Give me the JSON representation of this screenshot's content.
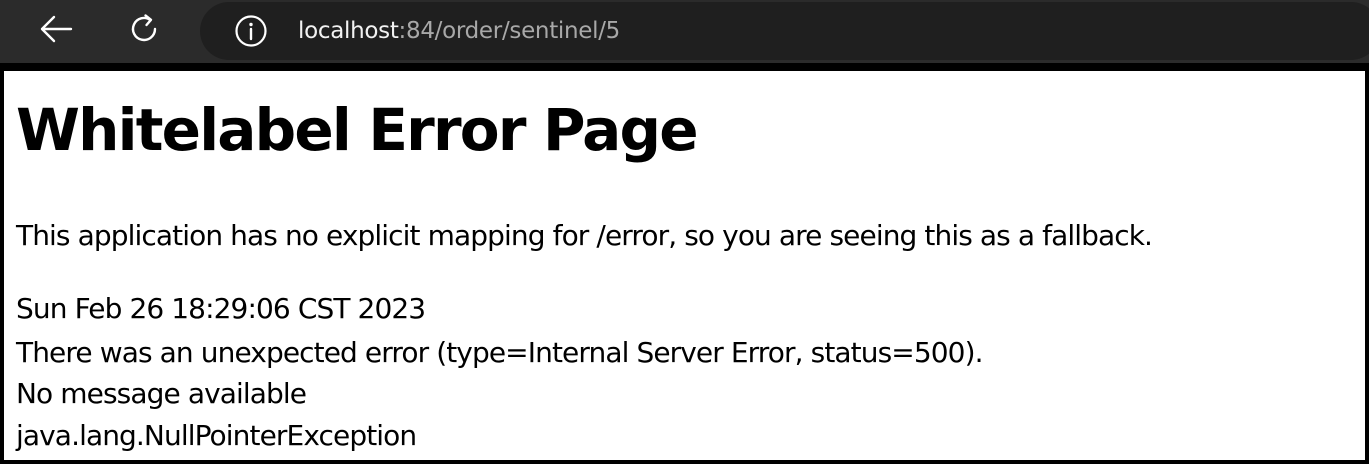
{
  "browser": {
    "url_host": "localhost",
    "url_path": ":84/order/sentinel/5",
    "icons": {
      "back": "arrow-left-icon",
      "reload": "reload-icon",
      "site_info": "info-icon"
    },
    "colors": {
      "toolbar": "#2b2b2b",
      "address_bar": "#1f1f1f",
      "url_host": "#f2f2f2",
      "url_path": "#a8a8a8"
    }
  },
  "page": {
    "title": "Whitelabel Error Page",
    "fallback_text": "This application has no explicit mapping for /error, so you are seeing this as a fallback.",
    "timestamp": "Sun Feb 26 18:29:06 CST 2023",
    "error_text": "There was an unexpected error (type=Internal Server Error, status=500).",
    "message": "No message available",
    "exception": "java.lang.NullPointerException"
  }
}
